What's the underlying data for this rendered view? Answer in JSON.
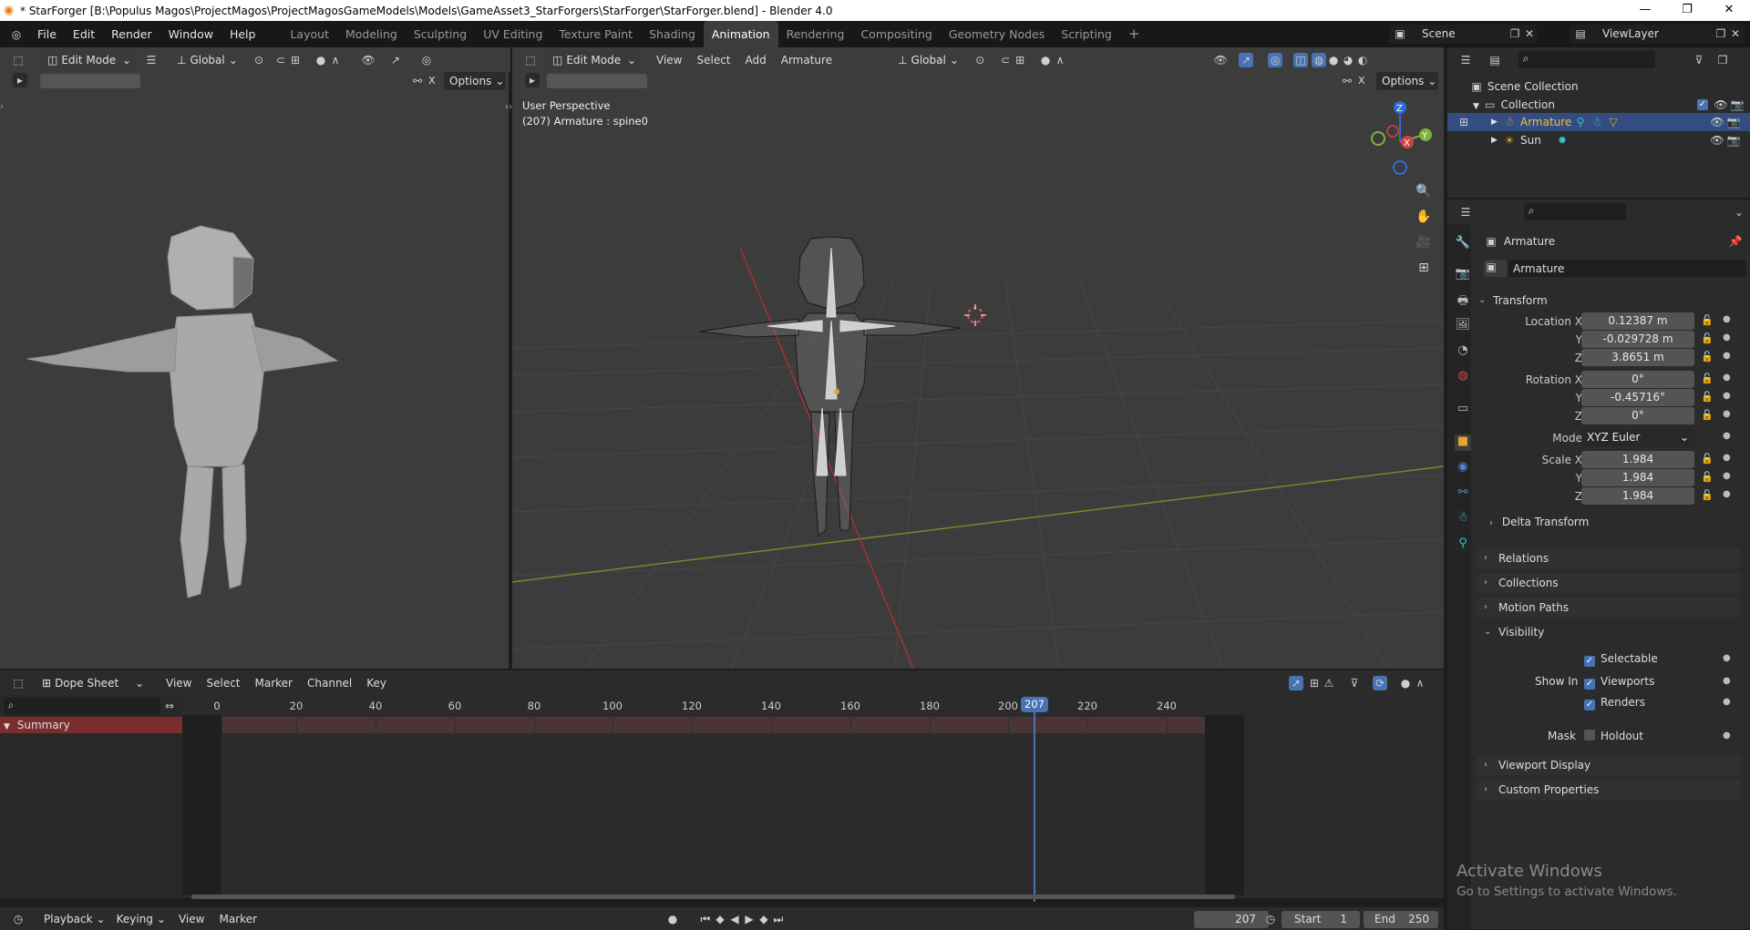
{
  "window": {
    "title": "* StarForger [B:\\Populus Magos\\ProjectMagos\\ProjectMagosGameModels\\Models\\GameAsset3_StarForgers\\StarForger\\StarForger.blend] - Blender 4.0"
  },
  "menu": [
    "File",
    "Edit",
    "Render",
    "Window",
    "Help"
  ],
  "workspaces": [
    "Layout",
    "Modeling",
    "Sculpting",
    "UV Editing",
    "Texture Paint",
    "Shading",
    "Animation",
    "Rendering",
    "Compositing",
    "Geometry Nodes",
    "Scripting"
  ],
  "active_workspace": "Animation",
  "scene": {
    "name": "Scene",
    "view_layer": "ViewLayer"
  },
  "left_viewport": {
    "mode": "Edit Mode",
    "orientation": "Global",
    "options": "Options",
    "x_label": "X"
  },
  "main_viewport": {
    "mode": "Edit Mode",
    "orientation": "Global",
    "menus": [
      "View",
      "Select",
      "Add",
      "Armature"
    ],
    "options": "Options",
    "x_label": "X",
    "info_line1": "User Perspective",
    "info_line2": "(207) Armature : spine0",
    "gizmo": {
      "z": "Z",
      "y": "Y",
      "x": "X"
    }
  },
  "outliner": {
    "root": "Scene Collection",
    "collection": "Collection",
    "items": [
      {
        "label": "Armature"
      },
      {
        "label": "Sun"
      }
    ]
  },
  "properties": {
    "object_name": "Armature",
    "data_name": "Armature",
    "transform_label": "Transform",
    "location": {
      "label": "Location X",
      "x": "0.12387 m",
      "y": "-0.029728 m",
      "z": "3.8651 m"
    },
    "rotation": {
      "label": "Rotation X",
      "x": "0°",
      "y": "-0.45716°",
      "z": "0°"
    },
    "mode": {
      "label": "Mode",
      "value": "XYZ Euler"
    },
    "scale": {
      "label": "Scale X",
      "x": "1.984",
      "y": "1.984",
      "z": "1.984"
    },
    "axis_y": "Y",
    "axis_z": "Z",
    "delta": "Delta Transform",
    "sections": [
      "Relations",
      "Collections",
      "Motion Paths"
    ],
    "visibility": {
      "label": "Visibility",
      "selectable": "Selectable",
      "show_in": "Show In",
      "viewports": "Viewports",
      "renders": "Renders",
      "mask": "Mask",
      "holdout": "Holdout"
    },
    "viewport_display": "Viewport Display",
    "custom_props": "Custom Properties"
  },
  "dopesheet": {
    "editor": "Dope Sheet",
    "menus": [
      "View",
      "Select",
      "Marker",
      "Channel",
      "Key"
    ],
    "summary": "Summary",
    "ticks": [
      "0",
      "20",
      "40",
      "60",
      "80",
      "100",
      "120",
      "140",
      "160",
      "180",
      "200",
      "220",
      "240"
    ],
    "current_frame": "207"
  },
  "timeline": {
    "menus": [
      "Playback",
      "Keying",
      "View",
      "Marker"
    ],
    "frame": "207",
    "start_label": "Start",
    "start": "1",
    "end_label": "End",
    "end": "250"
  },
  "watermark": {
    "line1": "Activate Windows",
    "line2": "Go to Settings to activate Windows."
  },
  "colors": {
    "accent": "#4772b3",
    "active": "#5680c2",
    "playhead": "#4772b3",
    "summary": "#7a2d2d"
  }
}
